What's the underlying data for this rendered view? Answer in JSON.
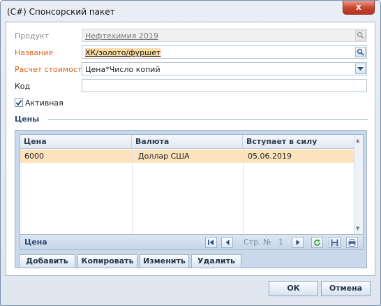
{
  "window": {
    "title": "(C#) Спонсорский пакет",
    "close_label": "x"
  },
  "form": {
    "product": {
      "label": "Продукт",
      "value": "Нефтехимия 2019"
    },
    "name": {
      "label": "Название",
      "value": "ХК/золото/фуршет"
    },
    "cost": {
      "label": "Расчет стоимости",
      "value": "Цена*Число копий"
    },
    "code": {
      "label": "Код",
      "value": ""
    },
    "active": {
      "label": "Активная",
      "checked": true
    }
  },
  "prices": {
    "section_title": "Цены",
    "columns": [
      "Цена",
      "Валюта",
      "Вступает в силу"
    ],
    "rows": [
      {
        "price": "6000",
        "currency": "Доллар США",
        "effective": "05.06.2019"
      }
    ],
    "footer": {
      "title": "Цена",
      "page_label": "Стр. №",
      "page_number": "1"
    },
    "actions": {
      "add": "Добавить",
      "copy": "Копировать",
      "edit": "Изменить",
      "delete": "Удалить"
    }
  },
  "dialog": {
    "ok": "ОК",
    "cancel": "Отмена"
  },
  "colors": {
    "accent_label": "#e0601a",
    "selected_row": "#fce3bd",
    "refresh_icon": "#3aa13a"
  }
}
